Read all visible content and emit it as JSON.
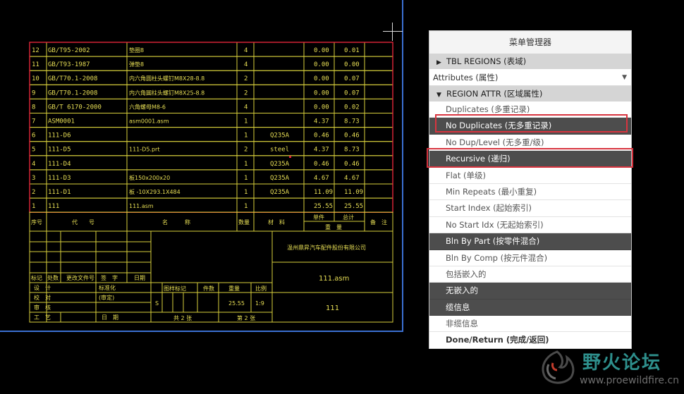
{
  "menu": {
    "title": "菜单管理器",
    "section_tbl_regions": "TBL REGIONS (表域)",
    "attributes_dropdown": "Attributes (属性)",
    "section_region_attr": "REGION ATTR (区域属性)",
    "items": [
      {
        "label": "Duplicates (多重记录)",
        "style": "normal"
      },
      {
        "label": "No Duplicates (无多重记录)",
        "style": "dark"
      },
      {
        "label": "No Dup/Level (无多重/级)",
        "style": "normal"
      },
      {
        "label": "Recursive (递归)",
        "style": "dark"
      },
      {
        "label": "Flat (单级)",
        "style": "normal"
      },
      {
        "label": "Min Repeats (最小重复)",
        "style": "normal"
      },
      {
        "label": "Start Index (起始索引)",
        "style": "normal"
      },
      {
        "label": "No Start Idx (无起始索引)",
        "style": "normal"
      },
      {
        "label": "Bln By Part (按零件混合)",
        "style": "dark"
      },
      {
        "label": "Bln By Comp (按元件混合)",
        "style": "normal"
      },
      {
        "label": "包括嵌入的",
        "style": "normal"
      },
      {
        "label": "无嵌入的",
        "style": "dark"
      },
      {
        "label": "缆信息",
        "style": "dark"
      },
      {
        "label": "非缆信息",
        "style": "normal"
      },
      {
        "label": "Done/Return (完成/返回)",
        "style": "bold"
      }
    ]
  },
  "bom": {
    "rows": [
      {
        "no": "12",
        "code": "GB/T95-2002",
        "name": "垫圈8",
        "qty": "4",
        "mat": "",
        "w1": "0.00",
        "w2": "0.01"
      },
      {
        "no": "11",
        "code": "GB/T93-1987",
        "name": "弹垫8",
        "qty": "4",
        "mat": "",
        "w1": "0.00",
        "w2": "0.00"
      },
      {
        "no": "10",
        "code": "GB/T70.1-2008",
        "name": "内六角圆柱头螺钉M8X28-8.8",
        "qty": "2",
        "mat": "",
        "w1": "0.00",
        "w2": "0.07"
      },
      {
        "no": "9",
        "code": "GB/T70.1-2008",
        "name": "内六角圆柱头螺钉M8X25-8.8",
        "qty": "2",
        "mat": "",
        "w1": "0.00",
        "w2": "0.07"
      },
      {
        "no": "8",
        "code": "GB/T 6170-2000",
        "name": "六角螺母M8-6",
        "qty": "4",
        "mat": "",
        "w1": "0.00",
        "w2": "0.02"
      },
      {
        "no": "7",
        "code": "ASM0001",
        "name": "asm0001.asm",
        "qty": "1",
        "mat": "",
        "w1": "4.37",
        "w2": "8.73"
      },
      {
        "no": "6",
        "code": "111-D6",
        "name": "",
        "qty": "1",
        "mat": "Q235A",
        "w1": "0.46",
        "w2": "0.46"
      },
      {
        "no": "5",
        "code": "111-D5",
        "name": "111-D5.prt",
        "qty": "2",
        "mat": "steel",
        "w1": "4.37",
        "w2": "8.73"
      },
      {
        "no": "4",
        "code": "111-D4",
        "name": "",
        "qty": "1",
        "mat": "Q235A",
        "w1": "0.46",
        "w2": "0.46"
      },
      {
        "no": "3",
        "code": "111-D3",
        "name": "板150x200x20",
        "qty": "1",
        "mat": "Q235A",
        "w1": "4.67",
        "w2": "4.67"
      },
      {
        "no": "2",
        "code": "111-D1",
        "name": "板 -10X293.1X484",
        "qty": "1",
        "mat": "Q235A",
        "w1": "11.09",
        "w2": "11.09"
      },
      {
        "no": "1",
        "code": "111",
        "name": "111.asm",
        "qty": "1",
        "mat": "",
        "w1": "25.55",
        "w2": "25.55"
      }
    ],
    "header": {
      "seq": "序号",
      "code": "代　　号",
      "name": "名　　　称",
      "qty": "数量",
      "mat": "材　料",
      "single": "单件",
      "total": "总计",
      "weight": "重　量",
      "remark": "备　注"
    }
  },
  "title_block": {
    "company": "温州鼎昇汽车配件股份有限公司",
    "drawing_name": "111.asm",
    "drawing_no": "111",
    "labels": {
      "mark": "标记",
      "count": "处数",
      "change_doc": "更改文件号",
      "sign": "签　字",
      "date": "日期",
      "design": "设　计",
      "std": "标准化",
      "check": "校　对",
      "review": "审　核",
      "process": "工　艺",
      "approve": "(审定)",
      "date2": "日　期",
      "stage": "图样标记",
      "weight": "件数",
      "mass": "重量",
      "scale": "比例",
      "sheets": "共 2 张",
      "sheet": "第 2 张",
      "stage_val": "S",
      "mass_val": "25.55",
      "scale_val": "1:9"
    }
  },
  "watermark": {
    "title": "野火论坛",
    "url": "www.proewildfire.cn"
  }
}
